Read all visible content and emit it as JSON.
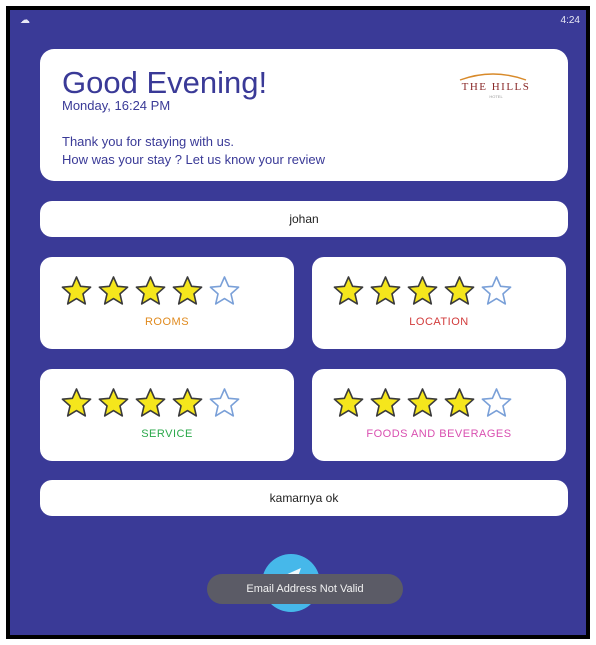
{
  "status_bar": {
    "time": "4:24"
  },
  "header": {
    "greeting": "Good Evening!",
    "datetime": "Monday, 16:24 PM",
    "message_line1": "Thank you for staying with us.",
    "message_line2": "How was your stay ? Let us know your review",
    "logo_text": "THE HILLS",
    "logo_subtext": "HOTEL"
  },
  "name_field": {
    "value": "johan"
  },
  "ratings": [
    {
      "label": "ROOMS",
      "stars": 4,
      "max": 5,
      "color": "#e08a1e"
    },
    {
      "label": "LOCATION",
      "stars": 4,
      "max": 5,
      "color": "#d23b3b"
    },
    {
      "label": "SERVICE",
      "stars": 4,
      "max": 5,
      "color": "#2aa84a"
    },
    {
      "label": "FOODS AND BEVERAGES",
      "stars": 4,
      "max": 5,
      "color": "#d94fb0"
    }
  ],
  "comment_field": {
    "value": "kamarnya ok"
  },
  "submit_button": {
    "icon": "send-icon"
  },
  "toast": {
    "message": "Email Address Not Valid"
  },
  "colors": {
    "background": "#3a3a97",
    "star_filled": "#f5e61c",
    "star_outline_empty": "#7aa0d8",
    "submit": "#46b8ea"
  }
}
